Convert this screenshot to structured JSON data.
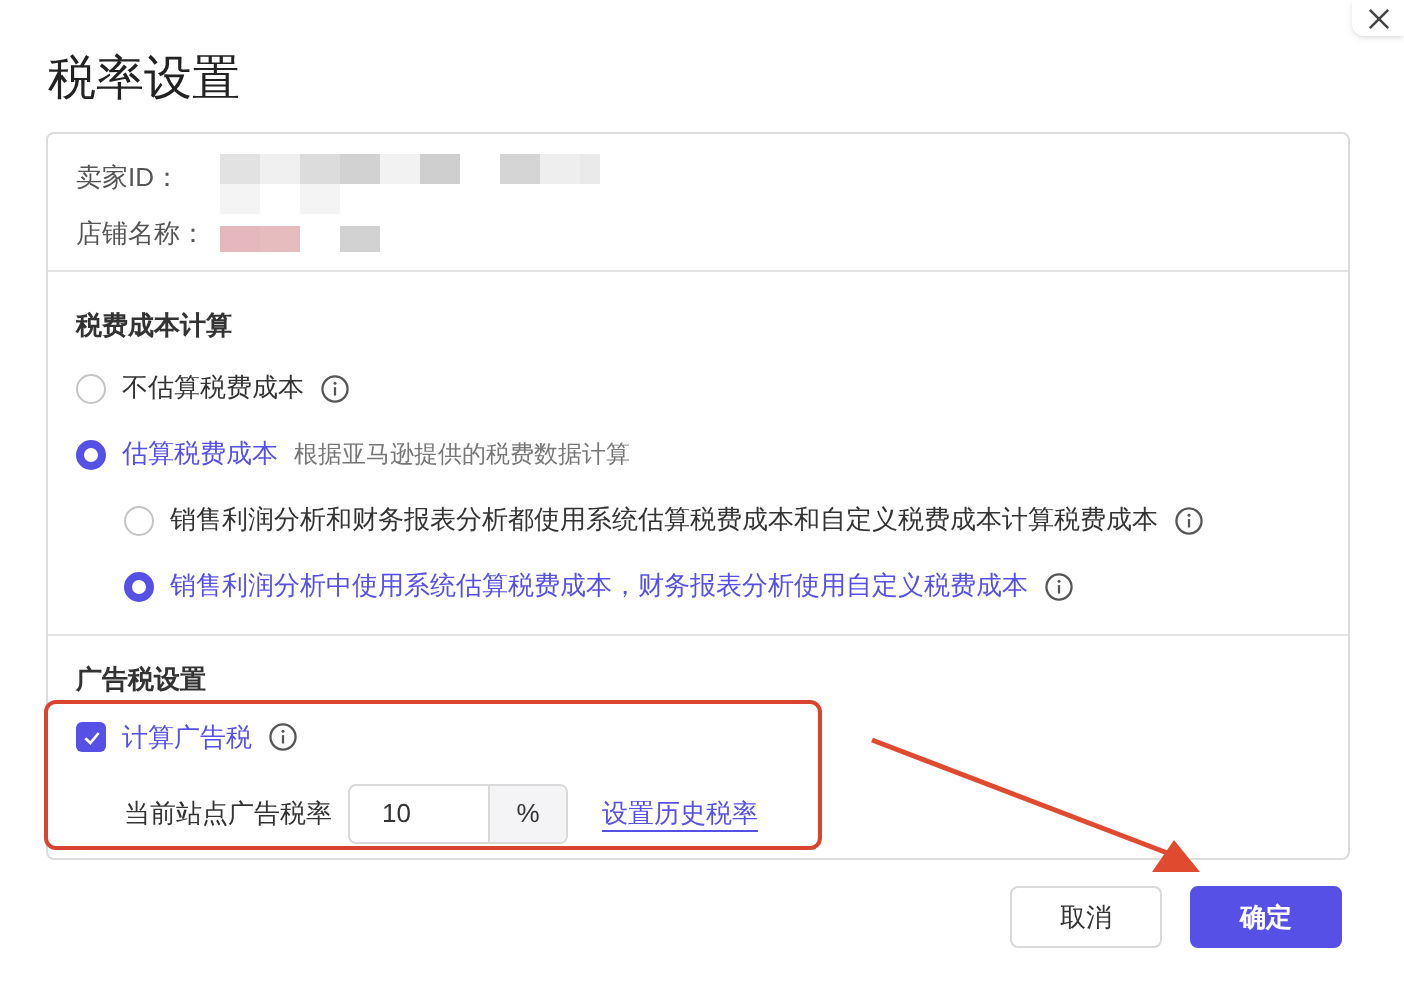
{
  "title": "税率设置",
  "seller_info": [
    {
      "label": "卖家ID："
    },
    {
      "label": "店铺名称："
    }
  ],
  "tax_cost": {
    "heading": "税费成本计算",
    "options": [
      {
        "label": "不估算税费成本",
        "selected": false,
        "info": true
      },
      {
        "label": "估算税费成本",
        "selected": true,
        "info": false,
        "note": "根据亚马逊提供的税费数据计算",
        "children": [
          {
            "label": "销售利润分析和财务报表分析都使用系统估算税费成本和自定义税费成本计算税费成本",
            "selected": false,
            "info": true
          },
          {
            "label": "销售利润分析中使用系统估算税费成本，财务报表分析使用自定义税费成本",
            "selected": true,
            "info": true
          }
        ]
      }
    ]
  },
  "ad_tax": {
    "heading": "广告税设置",
    "checkbox": {
      "label": "计算广告税",
      "checked": true,
      "info": true
    },
    "rate_label": "当前站点广告税率",
    "rate_value": "10",
    "unit": "%",
    "link": "设置历史税率"
  },
  "buttons": [
    {
      "label": "取消",
      "kind": "secondary"
    },
    {
      "label": "确定",
      "kind": "primary"
    }
  ]
}
